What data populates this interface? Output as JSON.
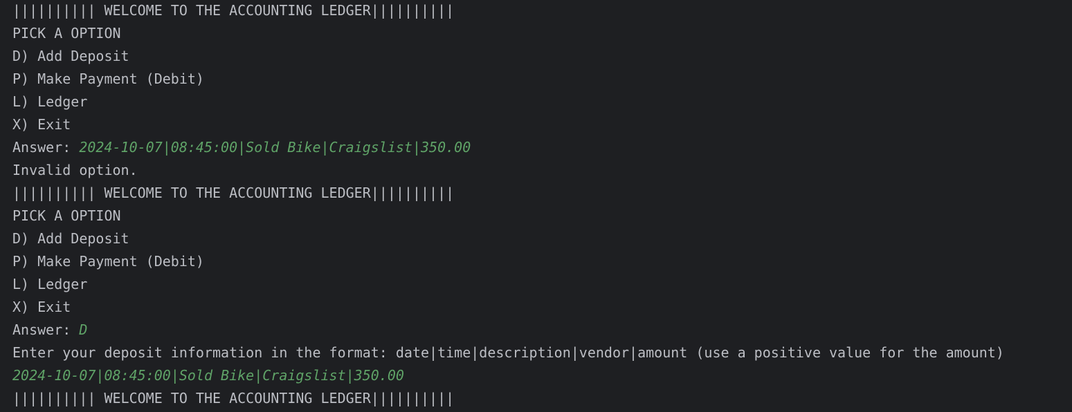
{
  "console": {
    "lines": [
      {
        "text": "|||||||||| WELCOME TO THE ACCOUNTING LEDGER||||||||||",
        "input": ""
      },
      {
        "text": "PICK A OPTION",
        "input": ""
      },
      {
        "text": "D) Add Deposit",
        "input": ""
      },
      {
        "text": "P) Make Payment (Debit)",
        "input": ""
      },
      {
        "text": "L) Ledger",
        "input": ""
      },
      {
        "text": "X) Exit",
        "input": ""
      },
      {
        "text": "Answer: ",
        "input": "2024-10-07|08:45:00|Sold Bike|Craigslist|350.00"
      },
      {
        "text": "Invalid option.",
        "input": ""
      },
      {
        "text": "|||||||||| WELCOME TO THE ACCOUNTING LEDGER||||||||||",
        "input": ""
      },
      {
        "text": "PICK A OPTION",
        "input": ""
      },
      {
        "text": "D) Add Deposit",
        "input": ""
      },
      {
        "text": "P) Make Payment (Debit)",
        "input": ""
      },
      {
        "text": "L) Ledger",
        "input": ""
      },
      {
        "text": "X) Exit",
        "input": ""
      },
      {
        "text": "Answer: ",
        "input": "D"
      },
      {
        "text": "Enter your deposit information in the format: date|time|description|vendor|amount (use a positive value for the amount)",
        "input": ""
      },
      {
        "text": "",
        "input": "2024-10-07|08:45:00|Sold Bike|Craigslist|350.00"
      },
      {
        "text": "|||||||||| WELCOME TO THE ACCOUNTING LEDGER||||||||||",
        "input": ""
      }
    ]
  },
  "colors": {
    "background": "#1e1f22",
    "output_text": "#bcbec4",
    "user_input": "#5fa367"
  }
}
